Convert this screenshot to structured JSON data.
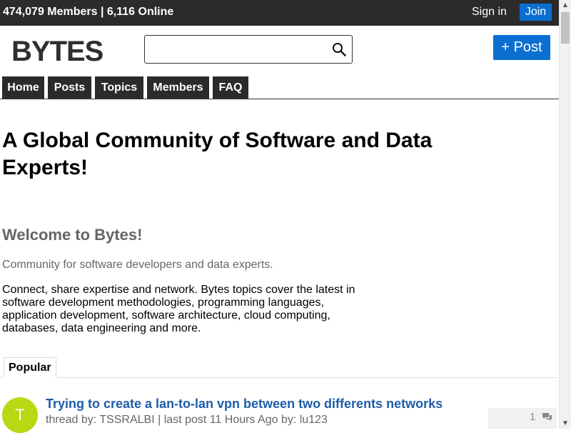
{
  "topbar": {
    "stats": "474,079 Members | 6,116 Online",
    "signin": "Sign in",
    "join": "Join"
  },
  "header": {
    "logo": "BYTES",
    "search_placeholder": "",
    "post_button": "+ Post"
  },
  "nav": {
    "tabs": [
      {
        "label": "Home"
      },
      {
        "label": "Posts"
      },
      {
        "label": "Topics"
      },
      {
        "label": "Members"
      },
      {
        "label": "FAQ"
      }
    ]
  },
  "main": {
    "headline": "A Global Community of Software and Data Experts!",
    "welcome": "Welcome to Bytes!",
    "tagline": "Community for software developers and data experts.",
    "description": "Connect, share expertise and network. Bytes topics cover the latest in software development methodologies, programming languages, application development, software architecture, cloud computing, databases, data engineering and more.",
    "popular_tab": "Popular"
  },
  "threads": [
    {
      "avatar_letter": "T",
      "avatar_color": "#b8d813",
      "title": "Trying to create a lan-to-lan vpn between two differents networks",
      "meta": "thread by: TSSRALBI | last post 11 Hours Ago by: lu123",
      "replies": "1"
    }
  ],
  "colors": {
    "topbar_bg": "#2b2b2b",
    "accent": "#0b6fd1",
    "link": "#1f5ca8"
  },
  "icons": [
    "search-icon",
    "comment-icon",
    "scroll-up-icon",
    "scroll-down-icon"
  ]
}
